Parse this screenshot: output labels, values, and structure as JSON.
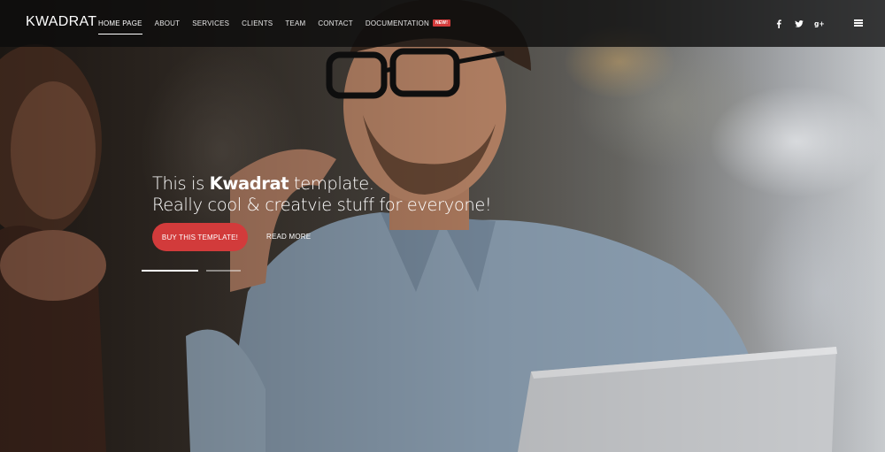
{
  "brand": {
    "logo": "KWADRAT"
  },
  "nav": {
    "items": [
      {
        "label": "HOME PAGE"
      },
      {
        "label": "ABOUT"
      },
      {
        "label": "SERVICES"
      },
      {
        "label": "CLIENTS"
      },
      {
        "label": "TEAM"
      },
      {
        "label": "CONTACT"
      },
      {
        "label": "DOCUMENTATION",
        "badge": "NEW!"
      }
    ],
    "active_index": 0
  },
  "social": [
    "facebook-icon",
    "twitter-icon",
    "google-plus-icon"
  ],
  "hero": {
    "line1_prefix": "This is ",
    "line1_brand": "Kwadrat",
    "line1_suffix": " template.",
    "line2": "Really cool & creatvie stuff for everyone!",
    "primary_button": "BUY THIS TEMPLATE!",
    "secondary_link": "READ MORE",
    "slides": {
      "count": 2,
      "active": 1
    }
  },
  "colors": {
    "accent": "#d23b3b",
    "navbar": "#0c0c0c"
  }
}
